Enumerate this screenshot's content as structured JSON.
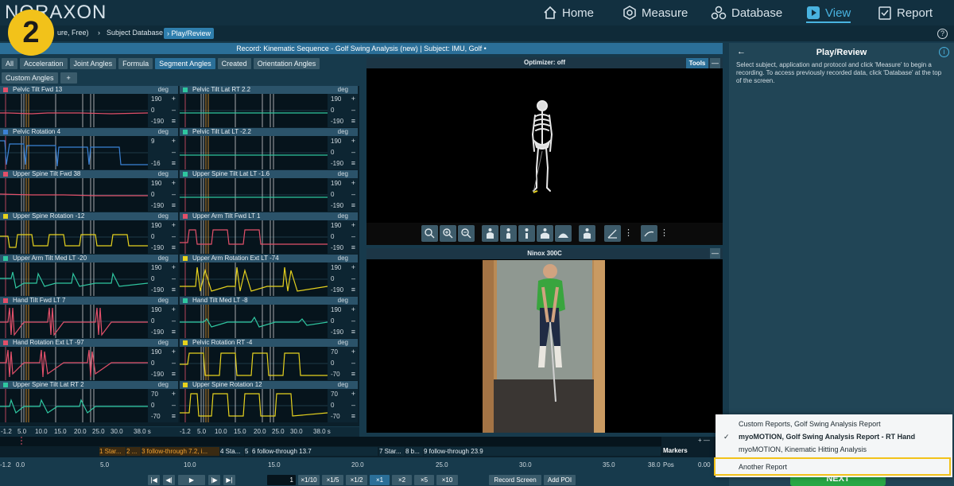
{
  "app": {
    "logo": "NORAXON"
  },
  "nav": [
    {
      "label": "Home",
      "icon": "home-icon"
    },
    {
      "label": "Measure",
      "icon": "measure-icon"
    },
    {
      "label": "Database",
      "icon": "database-icon"
    },
    {
      "label": "View",
      "icon": "view-icon",
      "active": true
    },
    {
      "label": "Report",
      "icon": "report-icon"
    }
  ],
  "breadcrumb": {
    "item1": "ure, Free)",
    "item2": "Subject Database",
    "item3": "Play/Review"
  },
  "step_badge": "2",
  "record_title": "Record: Kinematic Sequence - Golf Swing Analysis (new) | Subject: IMU, Golf •",
  "tabs": [
    "All",
    "Acceleration",
    "Joint Angles",
    "Formula",
    "Segment Angles",
    "Created",
    "Orientation Angles"
  ],
  "tabs2": [
    "Custom Angles",
    "+"
  ],
  "plots": [
    {
      "title": "Pelvic Tilt Fwd  13",
      "unit": "deg",
      "max": "190",
      "mid": "0",
      "min": "-190",
      "color": "#e2506a"
    },
    {
      "title": "Pelvic Tilt Lat RT  2.2",
      "unit": "deg",
      "max": "190",
      "mid": "0",
      "min": "-190",
      "color": "#2fc6a0"
    },
    {
      "title": "Pelvic Rotation  4",
      "unit": "deg",
      "max": "9",
      "mid": "",
      "min": "-16",
      "color": "#3b82d6"
    },
    {
      "title": "Pelvic Tilt Lat LT  -2.2",
      "unit": "deg",
      "max": "190",
      "mid": "0",
      "min": "-190",
      "color": "#2fc6a0"
    },
    {
      "title": "Upper Spine Tilt Fwd  38",
      "unit": "deg",
      "max": "190",
      "mid": "0",
      "min": "-190",
      "color": "#e2506a"
    },
    {
      "title": "Upper Spine Tilt Lat LT  -1.6",
      "unit": "deg",
      "max": "190",
      "mid": "0",
      "min": "-190",
      "color": "#2fc6a0"
    },
    {
      "title": "Upper Spine Rotation  -12",
      "unit": "deg",
      "max": "190",
      "mid": "0",
      "min": "-190",
      "color": "#e6d21e"
    },
    {
      "title": "Upper Arm Tilt Fwd LT  1",
      "unit": "deg",
      "max": "190",
      "mid": "0",
      "min": "-190",
      "color": "#e2506a"
    },
    {
      "title": "Upper Arm Tilt Med LT  -20",
      "unit": "deg",
      "max": "190",
      "mid": "0",
      "min": "-190",
      "color": "#2fc6a0"
    },
    {
      "title": "Upper Arm Rotation Ext LT  -74",
      "unit": "deg",
      "max": "190",
      "mid": "0",
      "min": "-190",
      "color": "#e6d21e"
    },
    {
      "title": "Hand Tilt Fwd LT  7",
      "unit": "deg",
      "max": "190",
      "mid": "0",
      "min": "-190",
      "color": "#e2506a"
    },
    {
      "title": "Hand Tilt Med LT  -8",
      "unit": "deg",
      "max": "190",
      "mid": "0",
      "min": "-190",
      "color": "#2fc6a0"
    },
    {
      "title": "Hand Rotation Ext LT  -97",
      "unit": "deg",
      "max": "190",
      "mid": "0",
      "min": "-190",
      "color": "#e2506a"
    },
    {
      "title": "Pelvic Rotation RT  -4",
      "unit": "deg",
      "max": "70",
      "mid": "0",
      "min": "-70",
      "color": "#e6d21e"
    },
    {
      "title": "Upper Spine Tilt Lat RT  2",
      "unit": "deg",
      "max": "70",
      "mid": "0",
      "min": "-70",
      "color": "#2fc6a0"
    },
    {
      "title": "Upper Spine Rotation  12",
      "unit": "deg",
      "max": "70",
      "mid": "0",
      "min": "-70",
      "color": "#e6d21e"
    }
  ],
  "plot_xaxis": {
    "ticks": [
      "-1.2",
      "5.0",
      "10.0",
      "15.0",
      "20.0",
      "25.0",
      "30.0"
    ],
    "end": "38.0 s"
  },
  "viewer": {
    "title": "Optimizer: off",
    "tools_label": "Tools",
    "collapse": "—"
  },
  "camera": {
    "title": "Ninox 300C",
    "collapse": "—"
  },
  "right_panel": {
    "title": "Play/Review",
    "text": "Select subject, application and protocol and click 'Measure' to begin a recording. To access previously recorded data, click 'Database' at the top of the screen."
  },
  "dropdown": {
    "items": [
      "Custom Reports, Golf Swing Analysis Report",
      "myoMOTION, Golf Swing Analysis Report - RT Hand",
      "myoMOTION, Kinematic Hitting Analysis",
      "Another Report"
    ],
    "selected_index": 1,
    "check": "✓"
  },
  "next_label": "NEXT",
  "markers": {
    "label": "Markers",
    "segments": [
      "1 Star...",
      "2 ...",
      "3 follow-through 7.2, i...",
      "4 Sta...",
      "5",
      "6 follow-through 13.7",
      "7 Star...",
      "8 b...",
      "9 follow-through 23.9"
    ]
  },
  "timeline_axis": {
    "ticks": [
      "-1.2",
      "0.0",
      "5.0",
      "10.0",
      "15.0",
      "20.0",
      "25.0",
      "30.0",
      "35.0",
      "38.0"
    ],
    "pos_label": "Pos",
    "pos_value": "0.00"
  },
  "playback": {
    "frame": "1",
    "speeds": [
      "×1/10",
      "×1/5",
      "×1/2",
      "×1",
      "×2",
      "×5",
      "×10"
    ],
    "selected_speed": "×1",
    "record_screen": "Record Screen",
    "add_poi": "Add POI"
  }
}
